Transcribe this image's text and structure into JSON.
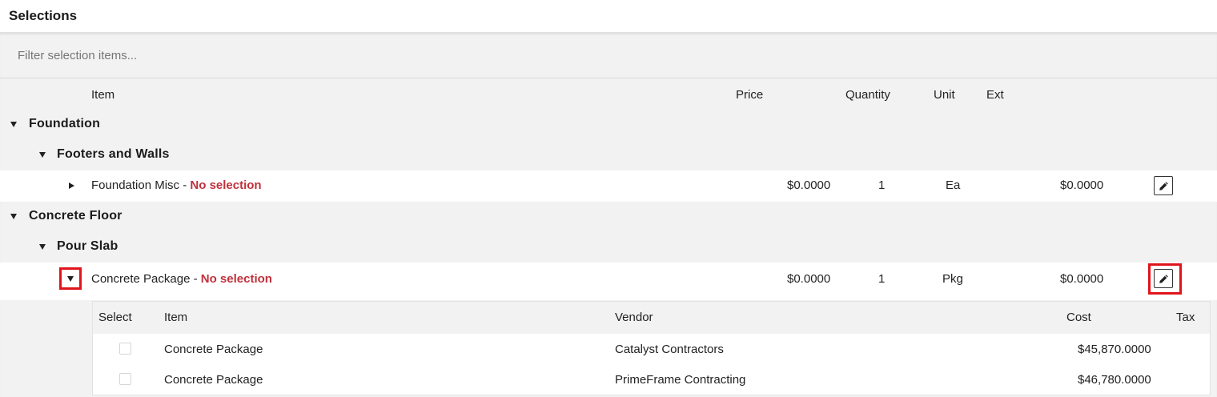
{
  "panel": {
    "title": "Selections"
  },
  "filter": {
    "placeholder": "Filter selection items..."
  },
  "columns": {
    "item": "Item",
    "price": "Price",
    "quantity": "Quantity",
    "unit": "Unit",
    "ext": "Ext"
  },
  "groups": [
    {
      "name": "Foundation",
      "subgroups": [
        {
          "name": "Footers and Walls",
          "items": [
            {
              "name": "Foundation Misc",
              "separator": " - ",
              "status": "No selection",
              "price": "$0.0000",
              "quantity": "1",
              "unit": "Ea",
              "ext": "$0.0000",
              "expanded": false
            }
          ]
        }
      ]
    },
    {
      "name": "Concrete Floor",
      "subgroups": [
        {
          "name": "Pour Slab",
          "items": [
            {
              "name": "Concrete Package",
              "separator": " - ",
              "status": "No selection",
              "price": "$0.0000",
              "quantity": "1",
              "unit": "Pkg",
              "ext": "$0.0000",
              "expanded": true
            }
          ]
        }
      ]
    }
  ],
  "options_table": {
    "headers": {
      "select": "Select",
      "item": "Item",
      "vendor": "Vendor",
      "cost": "Cost",
      "tax": "Tax"
    },
    "rows": [
      {
        "selected": false,
        "item": "Concrete Package",
        "vendor": "Catalyst Contractors",
        "cost": "$45,870.0000",
        "tax": ""
      },
      {
        "selected": false,
        "item": "Concrete Package",
        "vendor": "PrimeFrame Contracting",
        "cost": "$46,780.0000",
        "tax": ""
      }
    ]
  },
  "icons": {
    "edit": "pencil-icon",
    "expand": "caret-down-icon",
    "collapse": "caret-right-icon"
  },
  "colors": {
    "status_no_selection": "#c0313b",
    "highlight": "#e0141c",
    "panel_bg": "#f2f2f2"
  }
}
